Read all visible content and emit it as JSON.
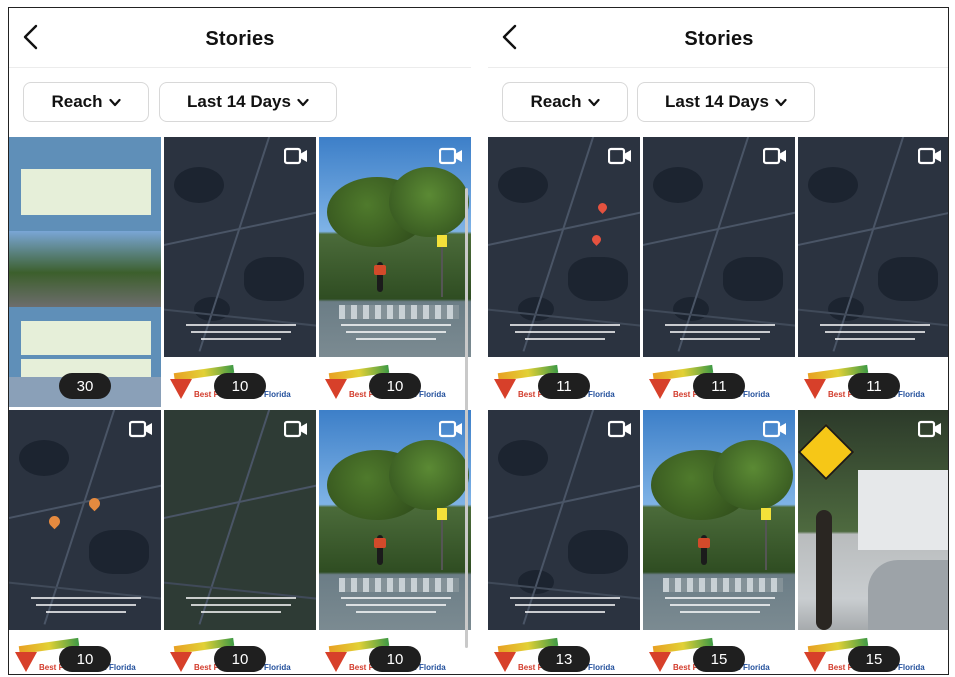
{
  "screens": [
    {
      "header": {
        "title": "Stories"
      },
      "filters": {
        "metric": "Reach",
        "range": "Last 14 Days"
      },
      "stories": [
        {
          "kind": "collage",
          "count": "30"
        },
        {
          "kind": "map",
          "count": "10"
        },
        {
          "kind": "photo",
          "count": "10"
        },
        {
          "kind": "map",
          "count": "10"
        },
        {
          "kind": "map-green",
          "count": "10"
        },
        {
          "kind": "photo",
          "count": "10"
        }
      ]
    },
    {
      "header": {
        "title": "Stories"
      },
      "filters": {
        "metric": "Reach",
        "range": "Last 14 Days"
      },
      "stories": [
        {
          "kind": "map",
          "count": "11"
        },
        {
          "kind": "map",
          "count": "11"
        },
        {
          "kind": "map",
          "count": "11"
        },
        {
          "kind": "map",
          "count": "13"
        },
        {
          "kind": "photo",
          "count": "15"
        },
        {
          "kind": "photo2",
          "count": "15"
        }
      ]
    }
  ],
  "icons": {
    "back": "chevron-left-icon",
    "video": "video-camera-icon",
    "dropdown": "chevron-down-icon"
  }
}
